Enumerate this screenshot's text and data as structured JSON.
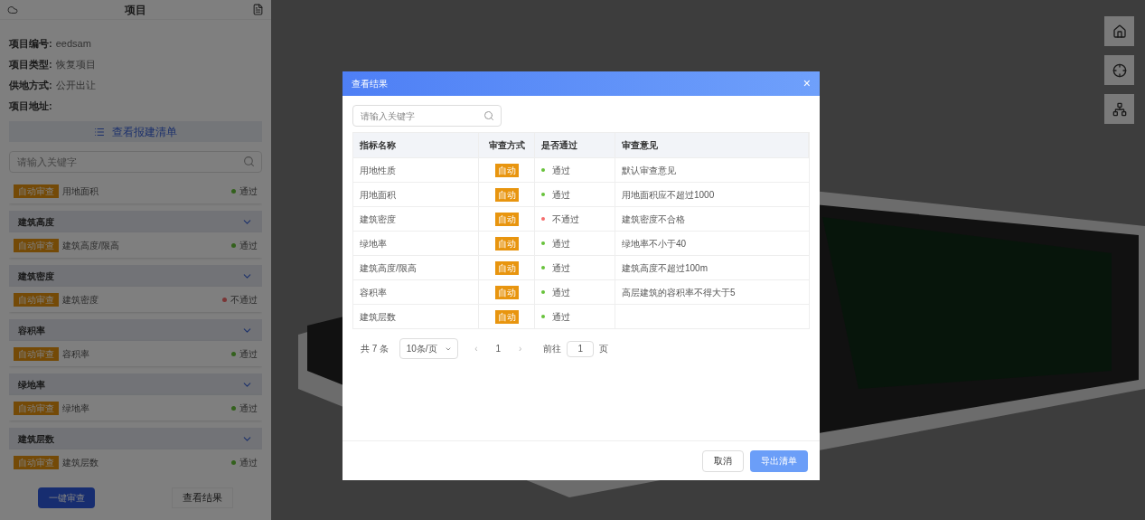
{
  "sidebar": {
    "title": "项目",
    "fields": [
      {
        "label": "项目编号:",
        "value": "eedsam"
      },
      {
        "label": "项目类型:",
        "value": "恢复项目"
      },
      {
        "label": "供地方式:",
        "value": "公开出让"
      },
      {
        "label": "项目地址:"
      }
    ],
    "list_button": "查看报建清单",
    "search": {
      "placeholder": "请输入关键字"
    },
    "groups": [
      {
        "items": [
          {
            "tag": "自动审查",
            "name": "用地面积",
            "status": "通过",
            "passed": true
          }
        ]
      },
      {
        "title": "建筑高度",
        "expanded": true,
        "items": [
          {
            "tag": "自动审查",
            "name": "建筑高度/限高",
            "status": "通过",
            "passed": true
          }
        ]
      },
      {
        "title": "建筑密度",
        "expanded": true,
        "items": [
          {
            "tag": "自动审查",
            "name": "建筑密度",
            "status": "不通过",
            "passed": false
          }
        ]
      },
      {
        "title": "容积率",
        "expanded": true,
        "items": [
          {
            "tag": "自动审查",
            "name": "容积率",
            "status": "通过",
            "passed": true
          }
        ]
      },
      {
        "title": "绿地率",
        "expanded": true,
        "items": [
          {
            "tag": "自动审查",
            "name": "绿地率",
            "status": "通过",
            "passed": true
          }
        ]
      },
      {
        "title": "建筑层数",
        "expanded": true,
        "items": [
          {
            "tag": "自动审查",
            "name": "建筑层数",
            "status": "通过",
            "passed": true
          }
        ]
      }
    ],
    "buttons": [
      {
        "label": "一键审查",
        "kind": "primary"
      },
      {
        "label": "查看结果",
        "kind": "default"
      }
    ]
  },
  "dialog": {
    "title": "查看结果",
    "close": "×",
    "search": {
      "placeholder": "请输入关键字"
    },
    "table": {
      "columns": [
        "指标名称",
        "审查方式",
        "是否通过",
        "审查意见"
      ],
      "rows": [
        {
          "name": "用地性质",
          "method": "自动",
          "result": "通过",
          "passed": true,
          "opinion": "默认审查意见"
        },
        {
          "name": "用地面积",
          "method": "自动",
          "result": "通过",
          "passed": true,
          "opinion": "用地面积应不超过1000"
        },
        {
          "name": "建筑密度",
          "method": "自动",
          "result": "不通过",
          "passed": false,
          "opinion": "建筑密度不合格"
        },
        {
          "name": "绿地率",
          "method": "自动",
          "result": "通过",
          "passed": true,
          "opinion": "绿地率不小于40"
        },
        {
          "name": "建筑高度/限高",
          "method": "自动",
          "result": "通过",
          "passed": true,
          "opinion": "建筑高度不超过100m"
        },
        {
          "name": "容积率",
          "method": "自动",
          "result": "通过",
          "passed": true,
          "opinion": "高层建筑的容积率不得大于5"
        },
        {
          "name": "建筑层数",
          "method": "自动",
          "result": "通过",
          "passed": true
        }
      ]
    },
    "pagination": {
      "total": "共 7 条",
      "page_size": "10条/页",
      "prev": "‹",
      "page": "1",
      "next": "›",
      "goto": "前往",
      "goto_value": "1",
      "page_unit": "页"
    },
    "buttons": [
      {
        "label": "取消",
        "kind": "default"
      },
      {
        "label": "导出清单",
        "kind": "primary"
      }
    ]
  }
}
